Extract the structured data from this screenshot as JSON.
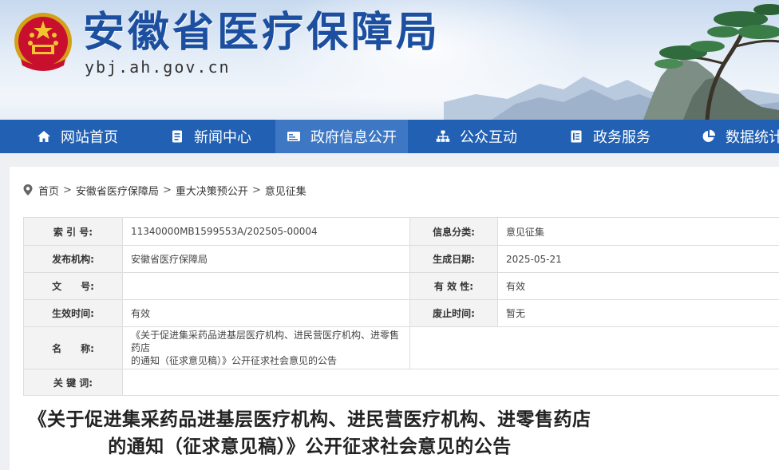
{
  "header": {
    "site_title": "安徽省医疗保障局",
    "site_domain": "ybj.ah.gov.cn",
    "emblem_icon": "national-emblem-icon"
  },
  "nav": {
    "items": [
      {
        "label": "网站首页",
        "icon": "home-icon"
      },
      {
        "label": "新闻中心",
        "icon": "document-icon"
      },
      {
        "label": "政府信息公开",
        "icon": "id-card-icon",
        "active": true
      },
      {
        "label": "公众互动",
        "icon": "org-chart-icon"
      },
      {
        "label": "政务服务",
        "icon": "list-icon"
      },
      {
        "label": "数据统计",
        "icon": "pie-chart-icon"
      }
    ]
  },
  "breadcrumb": {
    "items": [
      "首页",
      "安徽省医疗保障局",
      "重大决策预公开",
      "意见征集"
    ],
    "separator": ">"
  },
  "meta": {
    "index_label": "索 引 号:",
    "index_value": "11340000MB1599553A/202505-00004",
    "category_label": "信息分类:",
    "category_value": "意见征集",
    "publisher_label": "发布机构:",
    "publisher_value": "安徽省医疗保障局",
    "date_label": "生成日期:",
    "date_value": "2025-05-21",
    "docno_label": "文　　号:",
    "docno_value": "",
    "validity_label": "有 效 性:",
    "validity_value": "有效",
    "effective_label": "生效时间:",
    "effective_value": "有效",
    "repeal_label": "废止时间:",
    "repeal_value": "暂无",
    "name_label": "名　　称:",
    "name_value_line1": "《关于促进集采药品进基层医疗机构、进民营医疗机构、进零售药店",
    "name_value_line2": "的通知（征求意见稿）》公开征求社会意见的公告",
    "keywords_label": "关 键 词:",
    "keywords_value": ""
  },
  "document": {
    "title_line1": "《关于促进集采药品进基层医疗机构、进民营医疗机构、进零售药店",
    "title_line2": "的通知（征求意见稿）》公开征求社会意见的公告"
  },
  "colors": {
    "nav_bg": "#2160b3",
    "nav_active": "#3e78c4",
    "title_blue": "#1c4fa0"
  }
}
